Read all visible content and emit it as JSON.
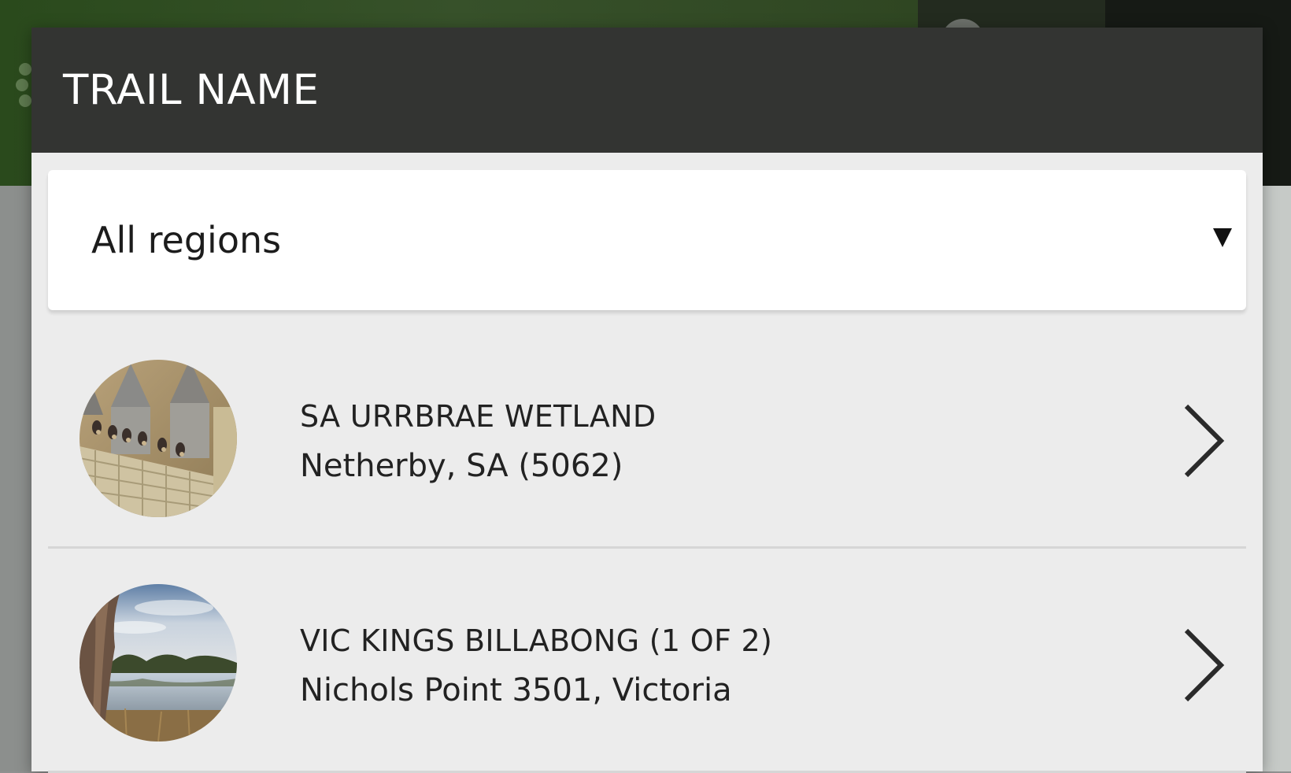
{
  "dialog": {
    "title": "TRAIL NAME"
  },
  "region_select": {
    "selected": "All regions",
    "arrow_icon": "dropdown-arrow-icon"
  },
  "trails": [
    {
      "name": "SA URRBRAE WETLAND",
      "location": "Netherby, SA (5062)",
      "thumbnail": "swallows-on-railing-photo",
      "chevron_icon": "chevron-right-icon"
    },
    {
      "name": "VIC KINGS BILLABONG (1 OF 2)",
      "location": "Nichols Point 3501, Victoria",
      "thumbnail": "billabong-landscape-photo",
      "chevron_icon": "chevron-right-icon"
    }
  ],
  "colors": {
    "header_bg": "#333432",
    "modal_bg": "#ececec",
    "background_green": "#37512a"
  }
}
